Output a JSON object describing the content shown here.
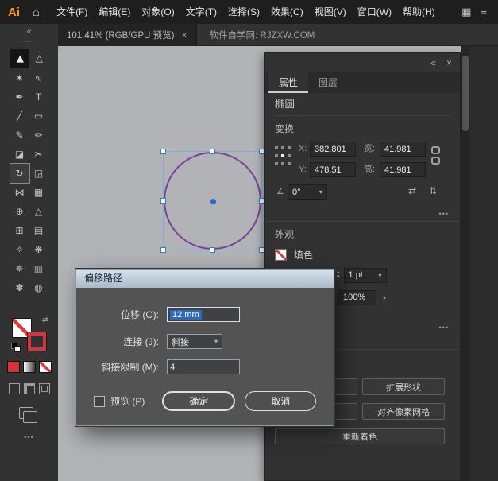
{
  "menu_bar": {
    "logo": "Ai",
    "items": [
      "文件(F)",
      "编辑(E)",
      "对象(O)",
      "文字(T)",
      "选择(S)",
      "效果(C)",
      "视图(V)",
      "窗口(W)",
      "帮助(H)"
    ]
  },
  "tab_bar": {
    "document_tab": "101.41% (RGB/GPU 预览)",
    "site_label": "软件自学网: RJZXW.COM"
  },
  "toolbar": {
    "tools": [
      {
        "name": "selection-tool",
        "glyph": "▶"
      },
      {
        "name": "direct-selection-tool",
        "glyph": "▷"
      },
      {
        "name": "magic-wand-tool",
        "glyph": "✶"
      },
      {
        "name": "lasso-tool",
        "glyph": "∿"
      },
      {
        "name": "pen-tool",
        "glyph": "✒"
      },
      {
        "name": "type-tool",
        "glyph": "T"
      },
      {
        "name": "line-tool",
        "glyph": "╱"
      },
      {
        "name": "rectangle-tool",
        "glyph": "▭"
      },
      {
        "name": "paintbrush-tool",
        "glyph": "✎"
      },
      {
        "name": "pencil-tool",
        "glyph": "✏"
      },
      {
        "name": "eraser-tool",
        "glyph": "◪"
      },
      {
        "name": "scissors-tool",
        "glyph": "✂"
      },
      {
        "name": "rotate-tool",
        "glyph": "↻"
      },
      {
        "name": "scale-tool",
        "glyph": "◲"
      },
      {
        "name": "width-tool",
        "glyph": "⋈"
      },
      {
        "name": "free-transform-tool",
        "glyph": "▦"
      },
      {
        "name": "shape-builder-tool",
        "glyph": "⊕"
      },
      {
        "name": "perspective-grid-tool",
        "glyph": "△"
      },
      {
        "name": "mesh-tool",
        "glyph": "⊞"
      },
      {
        "name": "gradient-tool",
        "glyph": "▤"
      },
      {
        "name": "eyedropper-tool",
        "glyph": "✧"
      },
      {
        "name": "blend-tool",
        "glyph": "❋"
      },
      {
        "name": "symbol-sprayer-tool",
        "glyph": "✵"
      },
      {
        "name": "column-graph-tool",
        "glyph": "▥"
      },
      {
        "name": "hand-tool",
        "glyph": "✽"
      },
      {
        "name": "zoom-tool",
        "glyph": "◍"
      }
    ],
    "fill": "none",
    "stroke_color": "#d5343c"
  },
  "canvas": {
    "selected_shape": "ellipse",
    "shape_stroke_color": "#7b3f9d",
    "selection_color": "#83aed6"
  },
  "properties_panel": {
    "tabs": [
      {
        "label": "属性",
        "active": true
      },
      {
        "label": "图层",
        "active": false
      }
    ],
    "object_type": "椭圆",
    "transform": {
      "title": "变换",
      "x_label": "X:",
      "x_value": "382.801",
      "y_label": "Y:",
      "y_value": "478.51",
      "w_label": "宽:",
      "w_value": "41.981",
      "h_label": "高:",
      "h_value": "41.981",
      "angle_value": "0°"
    },
    "appearance": {
      "title": "外观",
      "fill_label": "填色",
      "stroke_weight": "1 pt",
      "opacity": "100%"
    },
    "quick_actions": {
      "expand_shape": "扩展形状",
      "align_pixel_grid": "对齐像素网格",
      "recolor": "重新着色"
    }
  },
  "dialog": {
    "title": "偏移路径",
    "offset_label": "位移 (O):",
    "offset_value": "12 mm",
    "join_label": "连接 (J):",
    "join_value": "斜接",
    "miter_label": "斜接限制 (M):",
    "miter_value": "4",
    "preview_label": "预览 (P)",
    "ok_label": "确定",
    "cancel_label": "取消"
  },
  "glyphs": {
    "home": "⌂",
    "workspace": "▦",
    "menu": "≡",
    "collapse": "«",
    "close": "×",
    "more": "•••",
    "caret_down": "▾",
    "chevron_right": "›",
    "stepper_up": "▴",
    "stepper_down": "▾",
    "angle": "∠",
    "flip_h": "⇄",
    "flip_v": "⇅",
    "swap": "⇄",
    "grip": "····"
  }
}
